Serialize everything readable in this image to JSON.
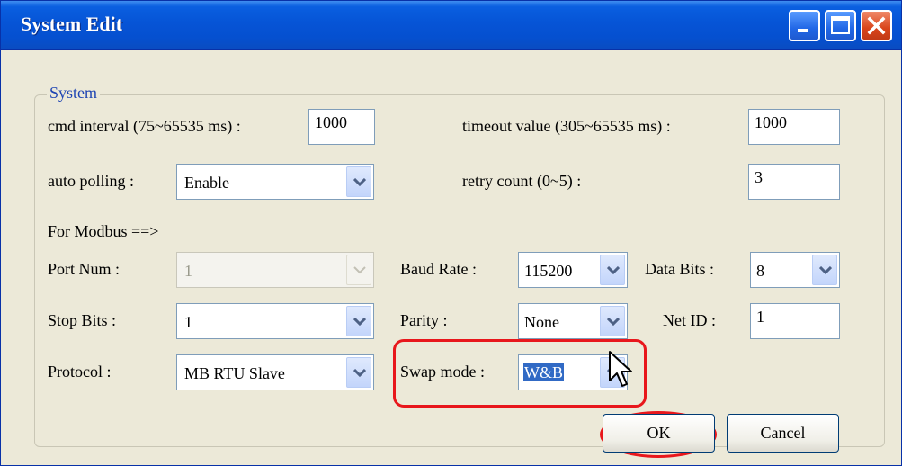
{
  "window": {
    "title": "System Edit"
  },
  "group": {
    "legend": "System"
  },
  "fields": {
    "cmd_interval": {
      "label": "cmd interval (75~65535 ms) :",
      "value": "1000"
    },
    "timeout": {
      "label": "timeout value (305~65535 ms) :",
      "value": "1000"
    },
    "auto_polling": {
      "label": "auto polling :",
      "value": "Enable"
    },
    "retry": {
      "label": "retry count (0~5) :",
      "value": "3"
    },
    "modbus_header": "For Modbus ==>",
    "port_num": {
      "label": "Port Num :",
      "value": "1"
    },
    "baud_rate": {
      "label": "Baud Rate :",
      "value": "115200"
    },
    "data_bits": {
      "label": "Data Bits :",
      "value": "8"
    },
    "stop_bits": {
      "label": "Stop Bits :",
      "value": "1"
    },
    "parity": {
      "label": "Parity :",
      "value": "None"
    },
    "net_id": {
      "label": "Net ID :",
      "value": "1"
    },
    "protocol": {
      "label": "Protocol :",
      "value": "MB RTU Slave"
    },
    "swap_mode": {
      "label": "Swap mode :",
      "value": "W&B"
    }
  },
  "buttons": {
    "ok": "OK",
    "cancel": "Cancel"
  },
  "colors": {
    "highlight": "#e8171c",
    "title_bar": "#0654d6",
    "legend_text": "#1f45b3"
  }
}
